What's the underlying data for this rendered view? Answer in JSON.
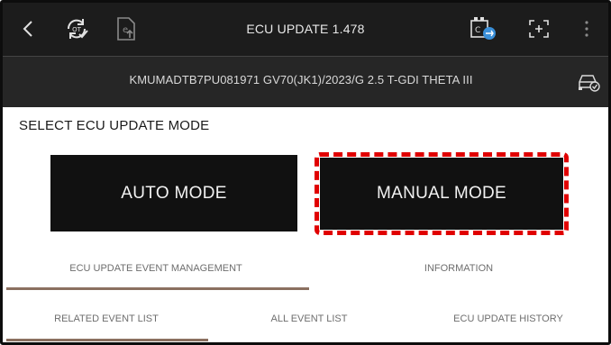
{
  "header": {
    "title": "ECU UPDATE 1.478",
    "icons": [
      "back-icon",
      "sync-icon",
      "document-upload-icon",
      "ecu-chip-icon",
      "fullscreen-icon",
      "more-options-icon"
    ]
  },
  "vehicle": {
    "info": "KMUMADTB7PU081971  GV70(JK1)/2023/G 2.5 T-GDI THETA III",
    "icon": "vehicle-check-icon"
  },
  "content": {
    "section_title": "SELECT ECU UPDATE MODE",
    "auto_label": "AUTO MODE",
    "manual_label": "MANUAL MODE",
    "highlight_color": "#e00000"
  },
  "tabs": {
    "primary": [
      "ECU UPDATE EVENT MANAGEMENT",
      "INFORMATION"
    ],
    "secondary": [
      "RELATED EVENT LIST",
      "ALL EVENT LIST",
      "ECU UPDATE HISTORY"
    ],
    "active_underline_color": "#8b7060"
  }
}
